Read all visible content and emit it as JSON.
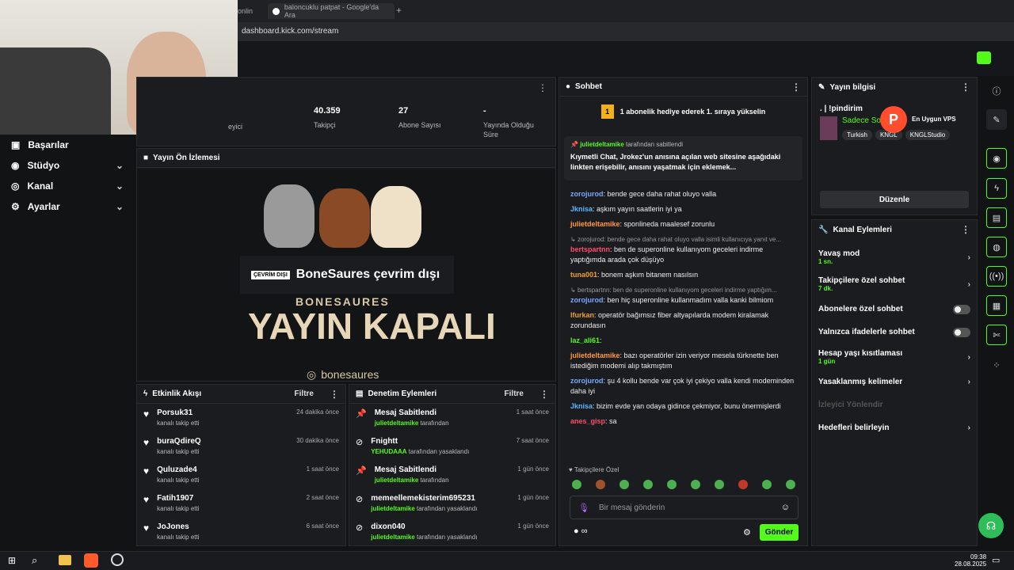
{
  "browser": {
    "tab1": "onlin",
    "tab2": "baloncuklu patpat - Google'da Ara",
    "url": "dashboard.kick.com/stream"
  },
  "sidebar": {
    "items": [
      {
        "label": "Başarılar"
      },
      {
        "label": "Stüdyo"
      },
      {
        "label": "Kanal"
      },
      {
        "label": "Ayarlar"
      }
    ]
  },
  "stats": [
    {
      "value": "",
      "label": "eyici"
    },
    {
      "value": "40.359",
      "label": "Takipçi"
    },
    {
      "value": "27",
      "label": "Abone Sayısı"
    },
    {
      "value": "-",
      "label": "Yayında Olduğu Süre"
    }
  ],
  "preview": {
    "title": "Yayın Ön İzlemesi",
    "offline_badge": "ÇEVRİM DIŞI",
    "offline_text": "BoneSaures çevrim dışı",
    "banner_top": "BONESAURES",
    "banner": "YAYIN KAPALI",
    "handle": "bonesaures"
  },
  "activity": {
    "title": "Etkinlik Akışı",
    "filter": "Filtre",
    "items": [
      {
        "name": "Porsuk31",
        "sub": "kanalı takip etti",
        "time": "24 dakika önce"
      },
      {
        "name": "buraQdireQ",
        "sub": "kanalı takip etti",
        "time": "30 dakika önce"
      },
      {
        "name": "Quluzade4",
        "sub": "kanalı takip etti",
        "time": "1 saat önce"
      },
      {
        "name": "Fatih1907",
        "sub": "kanalı takip etti",
        "time": "2 saat önce"
      },
      {
        "name": "JoJones",
        "sub": "kanalı takip etti",
        "time": "6 saat önce"
      }
    ]
  },
  "moderation": {
    "title": "Denetim Eylemleri",
    "filter": "Filtre",
    "items": [
      {
        "name": "Mesaj Sabitlendi",
        "user": "julietdeltamike",
        "action": "tarafından",
        "time": "1 saat önce"
      },
      {
        "name": "Fnightt",
        "user": "YEHUDAAA",
        "action": "tarafından yasaklandı",
        "time": "7 saat önce"
      },
      {
        "name": "Mesaj Sabitlendi",
        "user": "julietdeltamike",
        "action": "tarafından",
        "time": "1 gün önce"
      },
      {
        "name": "memeellemekisterim695231",
        "user": "julietdeltamike",
        "action": "tarafından yasaklandı",
        "time": "1 gün önce"
      },
      {
        "name": "dixon040",
        "user": "julietdeltamike",
        "action": "tarafından yasaklandı",
        "time": "1 gün önce"
      }
    ]
  },
  "chat": {
    "title": "Sohbet",
    "gift_banner": "1 abonelik hediye ederek 1. sıraya yükselin",
    "gift_num": "1",
    "pinned_by": "julietdeltamike",
    "pinned_suffix": "tarafından sabitlendi",
    "pinned_text": "Kıymetli Chat, Jrokez'un anısına açılan web sitesine aşağıdaki linkten erişebilir, anısını yaşatmak için eklemek...",
    "messages": [
      {
        "user": "zorojurod",
        "text": "bende gece daha rahat oluyo valla",
        "color": "#7aa7ff"
      },
      {
        "user": "Jknisa",
        "text": "aşkım yayın saatlerin iyi ya",
        "color": "#5ab7ff"
      },
      {
        "user": "julietdeltamike",
        "text": "sponlineda maalesef zorunlu",
        "color": "#ff9a3c"
      },
      {
        "reply": "zorojurod: bende gece daha rahat oluyo valla isimli kullanıcıya yanıt ve...",
        "user": "bertspartnn",
        "text": "ben de superonline kullanıyom geceleri indirme yaptığımda arada çok düşüyo",
        "color": "#ff4d6d"
      },
      {
        "user": "tuna001",
        "text": "bonem aşkım bitanem nasılsın",
        "color": "#f0a030"
      },
      {
        "reply": "bertspartnn: ben de superonline kullanıyom geceleri indirme yaptığım...",
        "user": "zorojurod",
        "text": "ben hiç superonline kullanmadım valla kanki bilmiom",
        "color": "#7aa7ff"
      },
      {
        "user": "lfurkan",
        "text": "operatör bağımsız fiber altyapılarda modem kiralamak zorundasın",
        "color": "#f0a030"
      },
      {
        "user": "laz_ali61",
        "text": "",
        "color": "#53fc18"
      },
      {
        "user": "julietdeltamike",
        "text": "bazı operatörler izin veriyor mesela türknette ben istediğim modemi alıp takmıştım",
        "color": "#ff9a3c"
      },
      {
        "user": "zorojurod",
        "text": "şu 4 kollu bende var çok iyi çekiyo valla kendi modeminden daha iyi",
        "color": "#7aa7ff"
      },
      {
        "user": "Jknisa",
        "text": "bizim evde yan odaya gidince çekmiyor, bunu önermişlerdi",
        "color": "#5ab7ff"
      },
      {
        "user": "anes_gisp",
        "text": "sa",
        "color": "#ff4d6d"
      }
    ],
    "followers_only": "Takipçilere Özel",
    "input_placeholder": "Bir mesaj gönderin",
    "send": "Gönder"
  },
  "stream_info": {
    "title": "Yayın bilgisi",
    "stream_title": ". | !pindirim",
    "category": "Sadece Soh",
    "tags": [
      "Turkish",
      "KNGL",
      "KNGLStudio"
    ],
    "edit": "Düzenle",
    "ad": "En Uygun VPS"
  },
  "channel_actions": {
    "title": "Kanal Eylemleri",
    "items": [
      {
        "label": "Yavaş mod",
        "sub": "1 sn.",
        "type": "chevron"
      },
      {
        "label": "Takipçilere özel sohbet",
        "sub": "7 dk.",
        "type": "chevron"
      },
      {
        "label": "Abonelere özel sohbet",
        "sub": "",
        "type": "toggle"
      },
      {
        "label": "Yalnızca ifadelerle sohbet",
        "sub": "",
        "type": "toggle"
      },
      {
        "label": "Hesap yaşı kısıtlaması",
        "sub": "1 gün",
        "type": "chevron"
      },
      {
        "label": "Yasaklanmış kelimeler",
        "sub": "",
        "type": "chevron"
      },
      {
        "label": "İzleyici Yönlendir",
        "sub": "",
        "type": "disabled"
      },
      {
        "label": "Hedefleri belirleyin",
        "sub": "",
        "type": "chevron"
      }
    ]
  },
  "taskbar": {
    "time": "09:38",
    "date": "28.08.2025"
  }
}
